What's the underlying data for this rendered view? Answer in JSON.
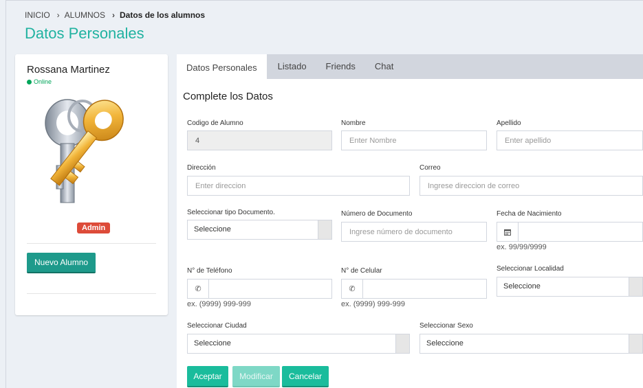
{
  "breadcrumb": {
    "home": "INICIO",
    "section": "ALUMNOS",
    "current": "Datos de los alumnos"
  },
  "page_title": "Datos Personales",
  "profile": {
    "name": "Rossana Martinez",
    "status": "Online",
    "badge": "Admin",
    "new_button": "Nuevo Alumno",
    "image_icon": "keys-icon"
  },
  "tabs": [
    "Datos Personales",
    "Listado",
    "Friends",
    "Chat"
  ],
  "form": {
    "title": "Complete los Datos",
    "codigo": {
      "label": "Codigo de Alumno",
      "value": "4"
    },
    "nombre": {
      "label": "Nombre",
      "placeholder": "Enter Nombre"
    },
    "apellido": {
      "label": "Apellido",
      "placeholder": "Enter apellido"
    },
    "direccion": {
      "label": "Dirección",
      "placeholder": "Enter direccion"
    },
    "correo": {
      "label": "Correo",
      "placeholder": "Ingrese direccion de correo"
    },
    "tipo_documento": {
      "label": "Seleccionar tipo Documento.",
      "value": "Seleccione"
    },
    "numero_documento": {
      "label": "Número de Documento",
      "placeholder": "Ingrese número de documento"
    },
    "fecha_nacimiento": {
      "label": "Fecha de Nacimiento",
      "hint": "ex. 99/99/9999",
      "icon": "calendar-icon"
    },
    "telefono": {
      "label": "N° de Teléfono",
      "hint": "ex. (9999) 999-999",
      "icon": "phone-icon"
    },
    "celular": {
      "label": "N° de Celular",
      "hint": "ex. (9999) 999-999",
      "icon": "phone-icon"
    },
    "localidad": {
      "label": "Seleccionar Localidad",
      "value": "Seleccione"
    },
    "ciudad": {
      "label": "Seleccionar Ciudad",
      "value": "Seleccione"
    },
    "sexo": {
      "label": "Seleccionar Sexo",
      "value": "Seleccione"
    }
  },
  "buttons": {
    "aceptar": "Aceptar",
    "modificar": "Modificar",
    "cancelar": "Cancelar"
  },
  "colors": {
    "accent": "#1abc9c",
    "title": "#20b2a0",
    "online": "#00a65a",
    "badge": "#dd4b39",
    "tabbar": "#d2d6de"
  }
}
